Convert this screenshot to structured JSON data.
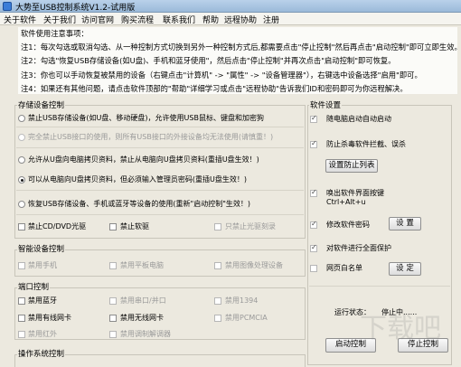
{
  "window": {
    "title": "大势至USB控制系统V1.2-试用版"
  },
  "menu": [
    "关于软件",
    "关于我们",
    "访问官网",
    "购买流程",
    "联系我们",
    "帮助",
    "远程协助",
    "注册"
  ],
  "notes": {
    "heading": "软件使用注意事项：",
    "lines": [
      "注1：每次勾选或取消勾选、从一种控制方式切换到另外一种控制方式后,都需要点击\"停止控制\"然后再点击\"启动控制\"即可立即生效。",
      "注2：勾选\"恢复USB存储设备(如U盘)、手机和蓝牙使用\"，然后点击\"停止控制\"并再次点击\"启动控制\"即可恢复。",
      "注3：你也可以手动恢复被禁用的设备（右键点击\"计算机\" -> \"属性\" -> \"设备管理器\"），右键选中设备选择\"启用\"即可。",
      "注4：如果还有其他问题，请点击软件顶部的\"帮助\"详细学习或点击\"远程协助\"告诉我们ID和密码即可为你远程解决。"
    ]
  },
  "storage": {
    "title": "存储设备控制",
    "options": [
      "禁止USB存储设备(如U盘、移动硬盘)，允许使用USB鼠标、键盘和加密狗",
      "完全禁止USB接口的使用，则所有USB接口的外接设备均无法使用(请慎重！)",
      "允许从U盘向电脑拷贝资料，禁止从电脑向U盘拷贝资料(重插U盘生效！)",
      "可以从电脑向U盘拷贝资料，但必须输入管理员密码(重插U盘生效！)",
      "恢复USB存储设备、手机或蓝牙等设备的使用(重新\"启动控制\"生效！)"
    ],
    "checks": [
      "禁止CD/DVD光驱",
      "禁止软驱",
      "只禁止光驱刻录"
    ]
  },
  "smart": {
    "title": "智能设备控制",
    "checks": [
      "禁用手机",
      "禁用平板电脑",
      "禁用图像处理设备"
    ]
  },
  "ports": {
    "title": "端口控制",
    "checks": [
      "禁用蓝牙",
      "禁用串口/并口",
      "禁用1394",
      "禁用有线网卡",
      "禁用无线网卡",
      "禁用PCMCIA",
      "禁用红外",
      "禁用调制解调器"
    ]
  },
  "os": {
    "title": "操作系统控制"
  },
  "settings": {
    "title": "软件设置",
    "items": {
      "autostart": "随电脑启动自动启动",
      "antikill": "防止杀毒软件拦截、误杀",
      "anti_list_btn": "设置防止列表",
      "hotkey_line1": "唤出软件界面按键",
      "hotkey_line2": "Ctrl+Alt+u",
      "password": "修改软件密码",
      "password_btn": "设 置",
      "protect": "对软件进行全面保护",
      "whitelist": "网页白名单",
      "whitelist_btn": "设 定"
    },
    "status_label": "运行状态：",
    "status_value": "停止中......",
    "start_btn": "启动控制",
    "stop_btn": "停止控制"
  },
  "watermark": "下载吧"
}
